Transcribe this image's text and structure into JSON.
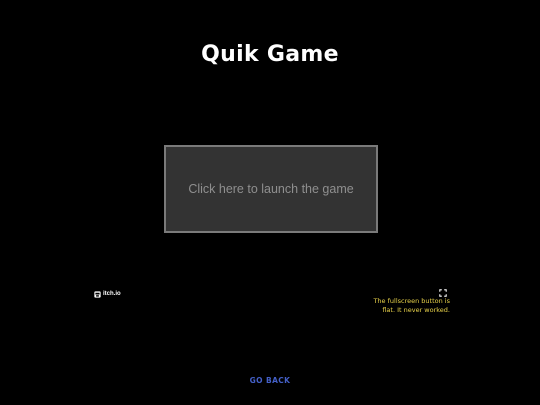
{
  "page": {
    "title": "Quik Game",
    "background_color": "#000000"
  },
  "launcher": {
    "label": "Click here to launch the game",
    "box_color": "#333333",
    "border_color": "#7a7a7a",
    "text_color": "#8f8f8f"
  },
  "footer": {
    "itch_logo_text": "itch.io",
    "itch_logo_icon": "itch-io-icon",
    "fullscreen_icon": "fullscreen-icon",
    "note": "The fullscreen button is flat. It never worked.",
    "note_color": "#e8d24a",
    "go_back_label": "GO BACK",
    "link_color": "#4460c8"
  }
}
